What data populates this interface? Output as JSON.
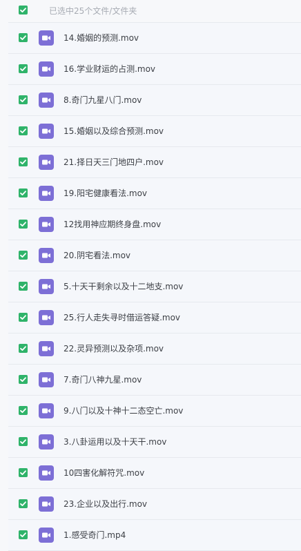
{
  "header": {
    "selection_text": "已选中25个文件/文件夹",
    "checkbox_state": "checked"
  },
  "colors": {
    "checkbox": "#2fb36a",
    "video_icon": "#7d6fd6",
    "text": "#3c3f45",
    "header_text": "#a7abb3"
  },
  "files": [
    {
      "name": "14.婚姻的预测.mov",
      "icon": "video-file-icon",
      "checked": true
    },
    {
      "name": "16.学业财运的占测.mov",
      "icon": "video-file-icon",
      "checked": true
    },
    {
      "name": "8.奇门九星八门.mov",
      "icon": "video-file-icon",
      "checked": true
    },
    {
      "name": "15.婚姻以及综合预测.mov",
      "icon": "video-file-icon",
      "checked": true
    },
    {
      "name": "21.择日天三门地四户.mov",
      "icon": "video-file-icon",
      "checked": true
    },
    {
      "name": "19.阳宅健康看法.mov",
      "icon": "video-file-icon",
      "checked": true
    },
    {
      "name": "12找用神应期终身盘.mov",
      "icon": "video-file-icon",
      "checked": true
    },
    {
      "name": "20.阴宅看法.mov",
      "icon": "video-file-icon",
      "checked": true
    },
    {
      "name": "5.十天干剩余以及十二地支.mov",
      "icon": "video-file-icon",
      "checked": true
    },
    {
      "name": "25.行人走失寻时借运答疑.mov",
      "icon": "video-file-icon",
      "checked": true
    },
    {
      "name": "22.灵异预测以及杂项.mov",
      "icon": "video-file-icon",
      "checked": true
    },
    {
      "name": "7.奇门八神九星.mov",
      "icon": "video-file-icon",
      "checked": true
    },
    {
      "name": "9.八门以及十神十二态空亡.mov",
      "icon": "video-file-icon",
      "checked": true
    },
    {
      "name": "3.八卦运用以及十天干.mov",
      "icon": "video-file-icon",
      "checked": true
    },
    {
      "name": "10四害化解符咒.mov",
      "icon": "video-file-icon",
      "checked": true
    },
    {
      "name": "23.企业以及出行.mov",
      "icon": "video-file-icon",
      "checked": true
    },
    {
      "name": "1.感受奇门.mp4",
      "icon": "video-file-icon",
      "checked": true
    }
  ]
}
